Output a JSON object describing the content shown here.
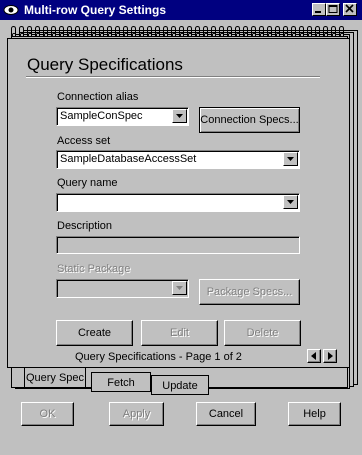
{
  "window": {
    "title": "Multi-row Query Settings",
    "controls": [
      "minimize",
      "maximize",
      "close"
    ]
  },
  "page": {
    "heading": "Query Specifications",
    "connection_alias": {
      "label": "Connection alias",
      "value": "SampleConSpec"
    },
    "connection_specs_button": "Connection Specs...",
    "access_set": {
      "label": "Access set",
      "value": "SampleDatabaseAccessSet"
    },
    "query_name": {
      "label": "Query name",
      "value": ""
    },
    "description": {
      "label": "Description",
      "value": ""
    },
    "static_package": {
      "label": "Static Package",
      "value": ""
    },
    "package_specs_button": "Package Specs...",
    "create_button": "Create",
    "edit_button": "Edit",
    "delete_button": "Delete",
    "page_indicator": "Query Specifications - Page 1 of 2"
  },
  "tabs": [
    {
      "label": "Query Spec",
      "selected": true
    },
    {
      "label": "Fetch",
      "selected": false
    },
    {
      "label": "Update",
      "selected": false
    }
  ],
  "footer": {
    "ok": "OK",
    "apply": "Apply",
    "cancel": "Cancel",
    "help": "Help"
  },
  "colors": {
    "titlebar": "#000080",
    "face": "#c0c0c0"
  }
}
